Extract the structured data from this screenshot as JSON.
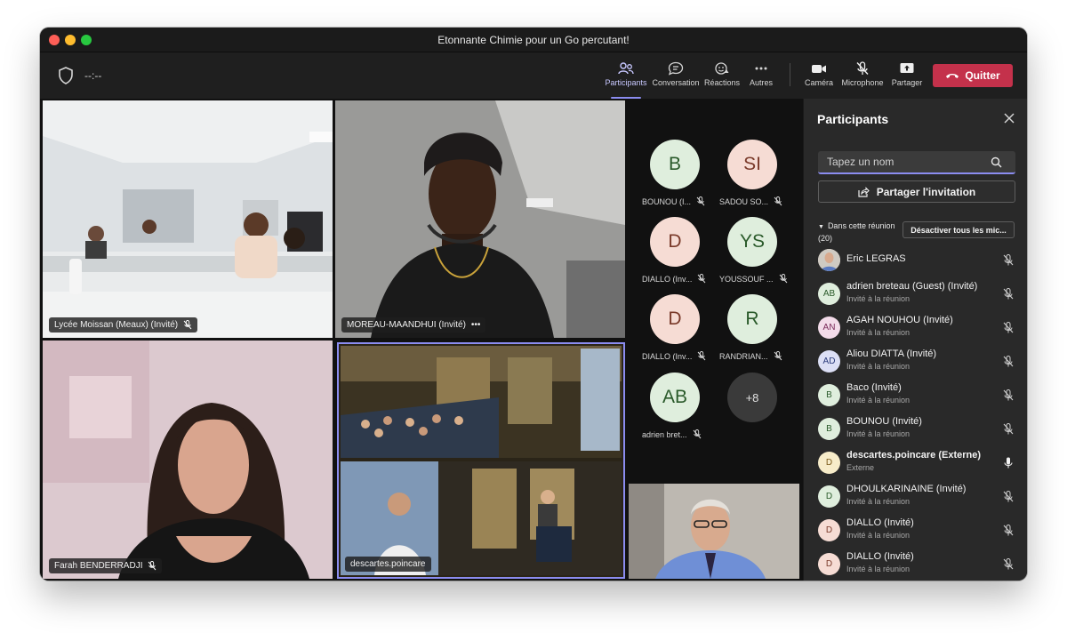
{
  "window": {
    "title": "Etonnante Chimie pour un Go percutant!"
  },
  "toolbar": {
    "timer": "--:--",
    "participants": "Participants",
    "conversation": "Conversation",
    "reactions": "Réactions",
    "more": "Autres",
    "camera": "Caméra",
    "microphone": "Microphone",
    "share": "Partager",
    "quit": "Quitter"
  },
  "video_tiles": [
    {
      "label": "Lycée Moissan (Meaux) (Invité)"
    },
    {
      "label": "MOREAU-MAANDHUI (Invité)",
      "more": "•••"
    },
    {
      "label": "Farah BENDERRADJI"
    },
    {
      "label": "descartes.poincare"
    }
  ],
  "avatar_tiles": [
    {
      "initials": "B",
      "caption": "BOUNOU (I...",
      "bg": "#dfeedd",
      "fg": "#2a5a2a"
    },
    {
      "initials": "SI",
      "caption": "SADOU SO...",
      "bg": "#f6dcd4",
      "fg": "#7a3a2a"
    },
    {
      "initials": "D",
      "caption": "DIALLO (Inv...",
      "bg": "#f6dcd4",
      "fg": "#7a3a2a"
    },
    {
      "initials": "YS",
      "caption": "YOUSSOUF ...",
      "bg": "#dfeedd",
      "fg": "#2a5a2a"
    },
    {
      "initials": "D",
      "caption": "DIALLO (Inv...",
      "bg": "#f6dcd4",
      "fg": "#7a3a2a"
    },
    {
      "initials": "R",
      "caption": "RANDRIAN...",
      "bg": "#dfeedd",
      "fg": "#2a5a2a"
    },
    {
      "initials": "AB",
      "caption": "adrien bret...",
      "bg": "#dfeedd",
      "fg": "#2a5a2a"
    },
    {
      "initials": "+8",
      "caption": "",
      "bg": "#3a3a3a",
      "fg": "#e0e0e0"
    }
  ],
  "panel": {
    "title": "Participants",
    "search_placeholder": "Tapez un nom",
    "invite": "Partager l'invitation",
    "section_label": "Dans cette réunion",
    "section_count": "(20)",
    "mute_all": "Désactiver tous les mic...",
    "participants": [
      {
        "initials": "",
        "name": "Eric LEGRAS",
        "sub": "",
        "photo": true
      },
      {
        "initials": "AB",
        "name": "adrien breteau (Guest) (Invité)",
        "sub": "Invité à la réunion",
        "bg": "#dfeedd",
        "fg": "#2a5a2a"
      },
      {
        "initials": "AN",
        "name": "AGAH NOUHOU (Invité)",
        "sub": "Invité à la réunion",
        "bg": "#f3dbe9",
        "fg": "#7a2a5a"
      },
      {
        "initials": "AD",
        "name": "Aliou DIATTA (Invité)",
        "sub": "Invité à la réunion",
        "bg": "#dcdff5",
        "fg": "#2a3a7a"
      },
      {
        "initials": "B",
        "name": "Baco (Invité)",
        "sub": "Invité à la réunion",
        "bg": "#dfeedd",
        "fg": "#2a5a2a"
      },
      {
        "initials": "B",
        "name": "BOUNOU (Invité)",
        "sub": "Invité à la réunion",
        "bg": "#dfeedd",
        "fg": "#2a5a2a"
      },
      {
        "initials": "D",
        "name": "descartes.poincare (Externe)",
        "sub": "Externe",
        "bg": "#f7ecc9",
        "fg": "#7a5a1a",
        "bold": true,
        "unmuted": true
      },
      {
        "initials": "D",
        "name": "DHOULKARINAINE (Invité)",
        "sub": "Invité à la réunion",
        "bg": "#dfeedd",
        "fg": "#2a5a2a"
      },
      {
        "initials": "D",
        "name": "DIALLO (Invité)",
        "sub": "Invité à la réunion",
        "bg": "#f6dcd4",
        "fg": "#7a3a2a"
      },
      {
        "initials": "D",
        "name": "DIALLO (Invité)",
        "sub": "Invité à la réunion",
        "bg": "#f6dcd4",
        "fg": "#7a3a2a"
      }
    ]
  },
  "colors": {
    "accent": "#8b8cf0",
    "quit": "#c4314b",
    "panel_bg": "#292929"
  }
}
